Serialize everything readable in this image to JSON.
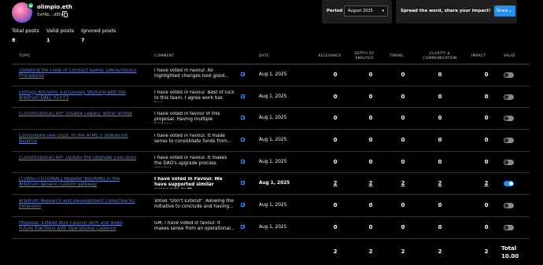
{
  "user": {
    "name": "olimpio.eth",
    "address": "0xf4b...d8fa"
  },
  "stats": [
    {
      "label": "Total posts",
      "value": "8"
    },
    {
      "label": "Valid posts",
      "value": "1"
    },
    {
      "label": "Ignored posts",
      "value": "7"
    }
  ],
  "period": {
    "label": "Period",
    "selected": "August 2025"
  },
  "share": {
    "text": "Spread the word, share your impact!",
    "button": "Share"
  },
  "table": {
    "headers": {
      "topic": "TOPIC",
      "comment": "COMMENT",
      "date": "DATE",
      "relevance": "RELEVANCE",
      "depth": "DEPTH OF ANALYSIS",
      "timing": "TIMING",
      "clarity": "CLARITY & COMMUNICATION",
      "impact": "IMPACT",
      "valid": "VALID"
    },
    "rows": [
      {
        "topic": "Updating the Code of Conduct &amp; DAO&rsquo;s Procedures",
        "comment": "I have voted in Favour. All highlighted changes look good...",
        "date": "Aug 1, 2025",
        "relevance": "0",
        "depth": "0",
        "timing": "0",
        "clarity": "0",
        "impact": "0",
        "valid": false
      },
      {
        "topic": "Entropy Advisors: Exclusively Working with the Arbitrum DAO, Y2+Y3",
        "comment": "I have voted in Favour. Best of luck to this team, I agree work has bee...",
        "date": "Aug 1, 2025",
        "relevance": "0",
        "depth": "0",
        "timing": "0",
        "clarity": "0",
        "impact": "0",
        "valid": false
      },
      {
        "topic": "[Constitutional] AIP: Disable Legacy Tether Bridge",
        "comment": "I have voted in favour of this proposal. Having multiple bridges...",
        "date": "Aug 1, 2025",
        "relevance": "0",
        "depth": "0",
        "timing": "0",
        "clarity": "0",
        "impact": "0",
        "valid": false
      },
      {
        "topic": "Consolidate Idle USDC to the ATMC's Stablecoin Balance",
        "comment": "I have voted in Favour. It made sense to consolidate funds from...",
        "date": "Aug 1, 2025",
        "relevance": "0",
        "depth": "0",
        "timing": "0",
        "clarity": "0",
        "impact": "0",
        "valid": false
      },
      {
        "topic": "[Constitutional] AIP: Update the Upgrade Executors",
        "comment": "I have voted in Favour. It makes the DAO's upgrade process simpler...",
        "date": "Aug 1, 2025",
        "relevance": "0",
        "depth": "0",
        "timing": "0",
        "clarity": "0",
        "impact": "0",
        "valid": false
      },
      {
        "topic": "[CONSTITUTIONAL] Register $BORING in the Arbitrum generic-custom gateway",
        "comment": "I have voted in Favour. We have supported similar proposals in th...",
        "date": "Aug 1, 2025",
        "relevance": "2",
        "depth": "2",
        "timing": "2",
        "clarity": "2",
        "impact": "2",
        "valid": true
      },
      {
        "topic": "Arbitrum Research and Development Collective V2 Extension",
        "comment": "Voted \"Don't Extend\". Allowing the initiative to conclude and having...",
        "date": "Aug 1, 2025",
        "relevance": "0",
        "depth": "0",
        "timing": "0",
        "clarity": "0",
        "impact": "0",
        "valid": false
      },
      {
        "topic": "Proposal: Extend AGV Council Term and Align Future Elections with Operational Cadence",
        "comment": "GM, I have voted in favour. It makes sense from an operational...",
        "date": "Aug 1, 2025",
        "relevance": "0",
        "depth": "0",
        "timing": "0",
        "clarity": "0",
        "impact": "0",
        "valid": false
      }
    ],
    "totals": {
      "relevance": "2",
      "depth": "2",
      "timing": "2",
      "clarity": "2",
      "impact": "2",
      "label": "Total",
      "value": "10.00"
    }
  }
}
